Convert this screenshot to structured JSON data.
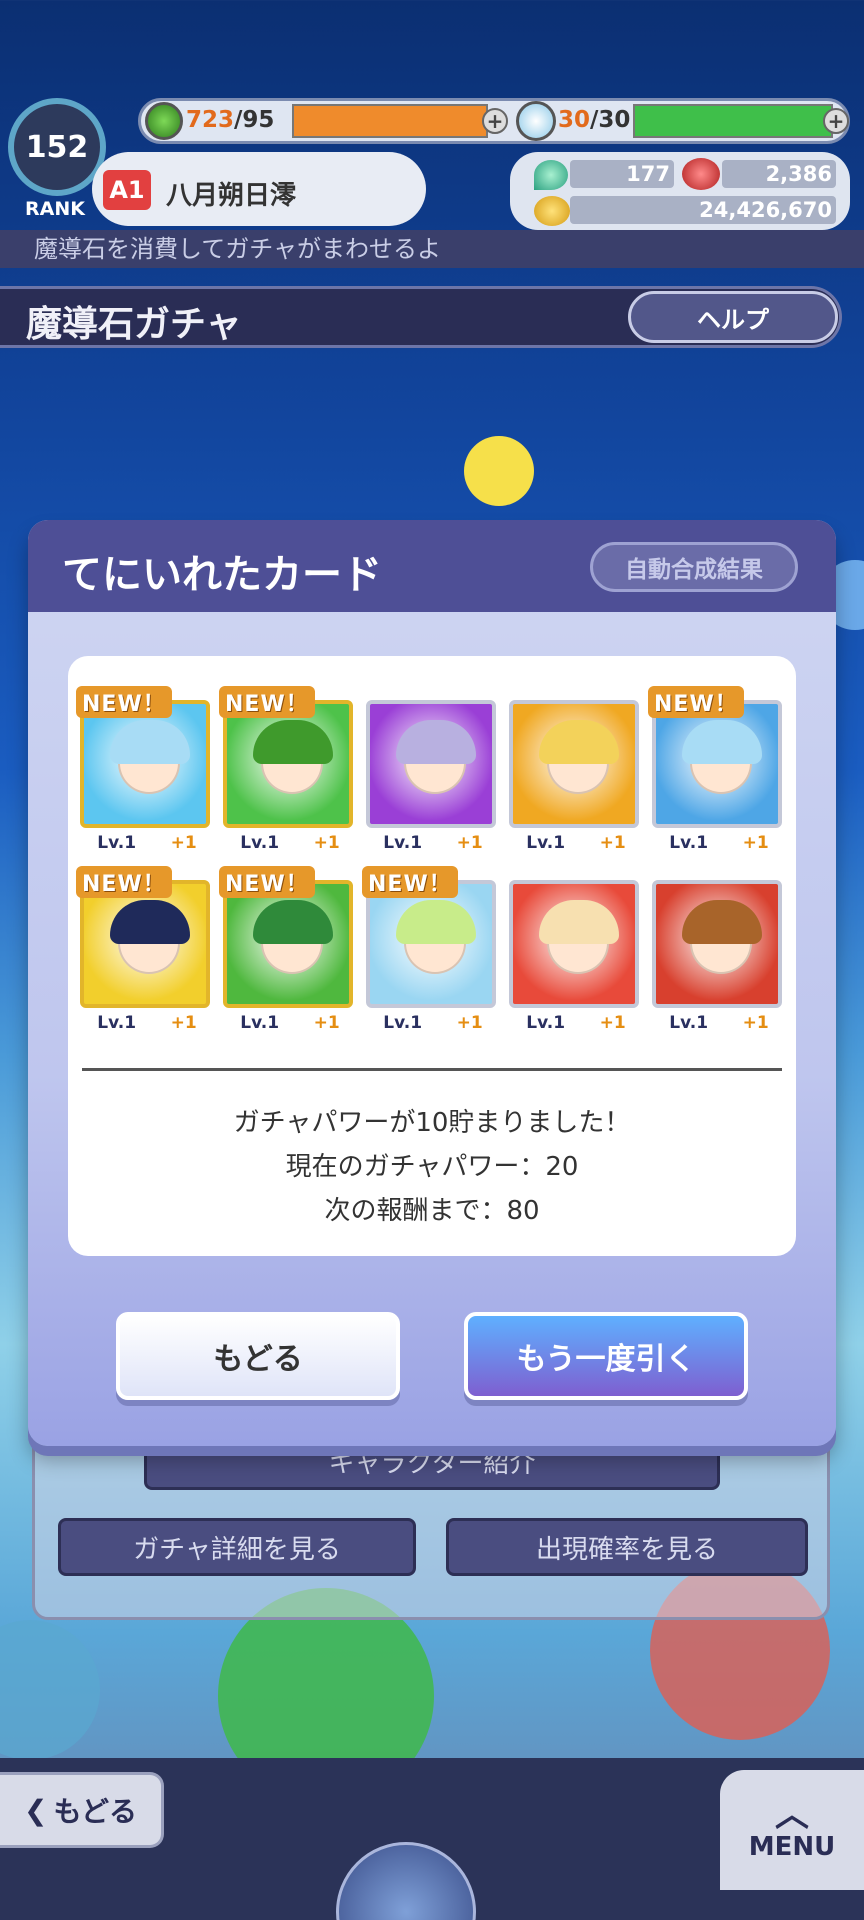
{
  "status": {
    "rank": "152",
    "rank_label": "RANK",
    "stamina_current": "723",
    "stamina_max": "/95",
    "potion_current": "30",
    "potion_max": "/30",
    "plus": "+"
  },
  "player": {
    "badge": "A1",
    "name": "八月朔日澪"
  },
  "currency": {
    "gems": "177",
    "meat": "2,386",
    "coins": "24,426,670"
  },
  "ticker": "魔導石を消費してガチャがまわせるよ",
  "gacha": {
    "title": "魔導石ガチャ",
    "help_label": "ヘルプ"
  },
  "under_panel": {
    "character_intro": "キャラクター紹介",
    "gacha_detail": "ガチャ詳細を見る",
    "rates": "出現確率を見る"
  },
  "modal": {
    "title": "てにいれたカード",
    "auto_fusion_label": "自動合成結果",
    "cards": [
      {
        "new": "NEW！",
        "level": "Lv.1",
        "plus": "+1",
        "color": "#5cc6f0",
        "hair": "#a8dcf5",
        "frame": "#e2b52a"
      },
      {
        "new": "NEW！",
        "level": "Lv.1",
        "plus": "+1",
        "color": "#4ec24a",
        "hair": "#3f9a2c",
        "frame": "#e2b52a"
      },
      {
        "new": "",
        "level": "Lv.1",
        "plus": "+1",
        "color": "#9a3fd6",
        "hair": "#b8b0e0",
        "frame": "#c4c8d8"
      },
      {
        "new": "",
        "level": "Lv.1",
        "plus": "+1",
        "color": "#f0a822",
        "hair": "#f3d25a",
        "frame": "#c4c8d8"
      },
      {
        "new": "NEW！",
        "level": "Lv.1",
        "plus": "+1",
        "color": "#4ea6e6",
        "hair": "#a8dcf5",
        "frame": "#c4c8d8"
      },
      {
        "new": "NEW！",
        "level": "Lv.1",
        "plus": "+1",
        "color": "#f2cf2c",
        "hair": "#1f2a5a",
        "frame": "#e2b52a"
      },
      {
        "new": "NEW！",
        "level": "Lv.1",
        "plus": "+1",
        "color": "#4fb83e",
        "hair": "#2f8a3a",
        "frame": "#e2b52a"
      },
      {
        "new": "NEW！",
        "level": "Lv.1",
        "plus": "+1",
        "color": "#9ad6f2",
        "hair": "#c8ec8a",
        "frame": "#c4c8d8"
      },
      {
        "new": "",
        "level": "Lv.1",
        "plus": "+1",
        "color": "#e84a3a",
        "hair": "#f7e0b0",
        "frame": "#c4c8d8"
      },
      {
        "new": "",
        "level": "Lv.1",
        "plus": "+1",
        "color": "#d8402e",
        "hair": "#a8642a",
        "frame": "#c4c8d8"
      }
    ],
    "result_line_1": "ガチャパワーが10貯まりました！",
    "result_line_2": "現在のガチャパワー：20",
    "result_line_3": "次の報酬まで：80",
    "back_label": "もどる",
    "again_label": "もう一度引く"
  },
  "nav": {
    "back_label": "もどる",
    "menu_label": "MENU"
  }
}
